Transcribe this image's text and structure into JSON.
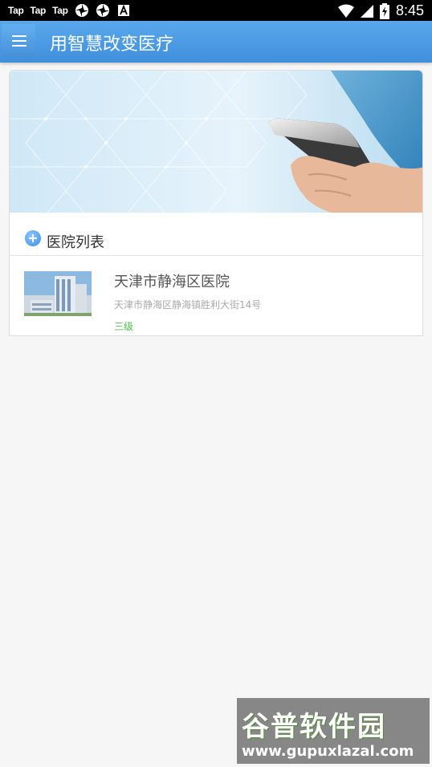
{
  "status_bar": {
    "tap_labels": [
      "Tap",
      "Tap",
      "Tap"
    ],
    "time": "8:45"
  },
  "app_bar": {
    "title": "用智慧改变医疗",
    "menu_icon": "hamburger-icon"
  },
  "section": {
    "title": "医院列表",
    "icon": "plus-circle-icon"
  },
  "hospitals": [
    {
      "name": "天津市静海区医院",
      "address": "天津市静海区静海镇胜利大街14号",
      "level": "三级"
    }
  ],
  "watermark": {
    "line1": "谷普软件园",
    "line2": "www.gupuxlazal.com"
  },
  "colors": {
    "accent": "#4a9be6",
    "level_green": "#4cc24c"
  }
}
